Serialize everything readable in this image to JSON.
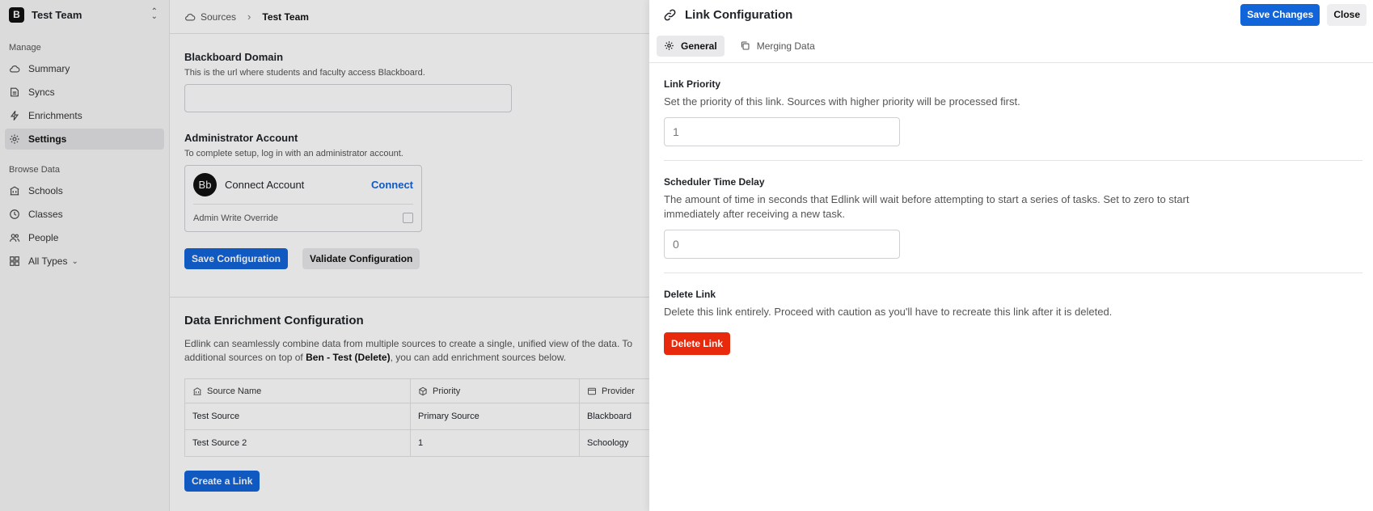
{
  "team": {
    "badge": "B",
    "name": "Test Team"
  },
  "sidebar": {
    "manage_heading": "Manage",
    "manage_items": [
      {
        "label": "Summary",
        "icon": "cloud-icon"
      },
      {
        "label": "Syncs",
        "icon": "document-icon"
      },
      {
        "label": "Enrichments",
        "icon": "bolt-icon"
      },
      {
        "label": "Settings",
        "icon": "gear-icon",
        "active": true
      }
    ],
    "browse_heading": "Browse Data",
    "browse_items": [
      {
        "label": "Schools",
        "icon": "building-icon"
      },
      {
        "label": "Classes",
        "icon": "clock-icon"
      },
      {
        "label": "People",
        "icon": "people-icon"
      },
      {
        "label": "All Types",
        "icon": "grid-icon"
      }
    ]
  },
  "breadcrumb": {
    "sources": "Sources",
    "current": "Test Team"
  },
  "main": {
    "domain": {
      "title": "Blackboard Domain",
      "desc": "This is the url where students and faculty access Blackboard.",
      "value": ""
    },
    "admin": {
      "title": "Administrator Account",
      "desc": "To complete setup, log in with an administrator account.",
      "logo": "Bb",
      "connect_label": "Connect Account",
      "connect_link": "Connect",
      "override_label": "Admin Write Override"
    },
    "save_config": "Save Configuration",
    "validate_config": "Validate Configuration",
    "enrichment": {
      "title": "Data Enrichment Configuration",
      "desc_part1": "Edlink can seamlessly combine data from multiple sources to create a single, unified view of the data. To",
      "desc_part2": "additional sources on top of ",
      "desc_bold": "Ben - Test (Delete)",
      "desc_part3": ", you can add enrichment sources below.",
      "columns": [
        "Source Name",
        "Priority",
        "Provider"
      ],
      "rows": [
        [
          "Test Source",
          "Primary Source",
          "Blackboard"
        ],
        [
          "Test Source 2",
          "1",
          "Schoology"
        ]
      ],
      "create_link": "Create a Link"
    }
  },
  "panel": {
    "title": "Link Configuration",
    "save_changes": "Save Changes",
    "close": "Close",
    "tabs": [
      {
        "label": "General",
        "active": true
      },
      {
        "label": "Merging Data",
        "active": false
      }
    ],
    "priority": {
      "title": "Link Priority",
      "desc": "Set the priority of this link. Sources with higher priority will be processed first.",
      "value": "1"
    },
    "delay": {
      "title": "Scheduler Time Delay",
      "desc": "The amount of time in seconds that Edlink will wait before attempting to start a series of tasks. Set to zero to start immediately after receiving a new task.",
      "value": "0"
    },
    "delete": {
      "title": "Delete Link",
      "desc": "Delete this link entirely. Proceed with caution as you'll have to recreate this link after it is deleted.",
      "button": "Delete Link"
    }
  },
  "colors": {
    "accent": "#1264d9",
    "danger": "#e8290b"
  }
}
